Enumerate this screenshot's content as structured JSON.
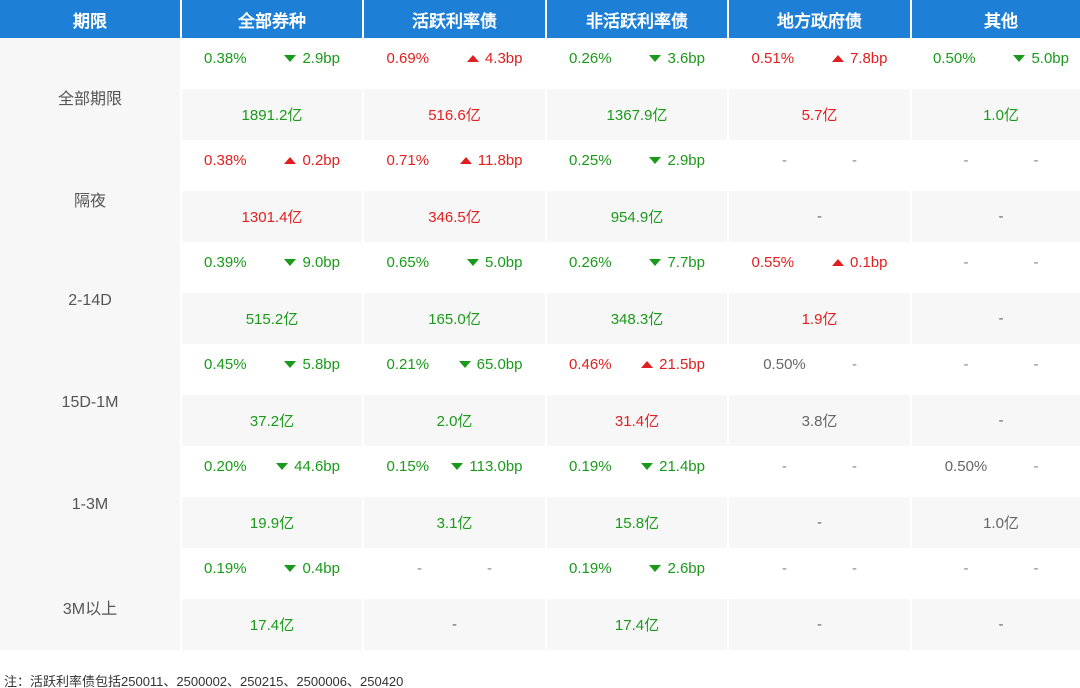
{
  "chart_data": {
    "type": "table",
    "headers": [
      "期限",
      "全部券种",
      "活跃利率债",
      "非活跃利率债",
      "地方政府债",
      "其他"
    ],
    "rows": [
      {
        "label": "全部期限",
        "cells": [
          {
            "rate": "0.38%",
            "dir": "down",
            "change": "2.9bp",
            "vol": "1891.2亿"
          },
          {
            "rate": "0.69%",
            "dir": "up",
            "change": "4.3bp",
            "vol": "516.6亿"
          },
          {
            "rate": "0.26%",
            "dir": "down",
            "change": "3.6bp",
            "vol": "1367.9亿"
          },
          {
            "rate": "0.51%",
            "dir": "up",
            "change": "7.8bp",
            "vol": "5.7亿"
          },
          {
            "rate": "0.50%",
            "dir": "down",
            "change": "5.0bp",
            "vol": "1.0亿"
          }
        ]
      },
      {
        "label": "隔夜",
        "cells": [
          {
            "rate": "0.38%",
            "dir": "up",
            "change": "0.2bp",
            "vol": "1301.4亿"
          },
          {
            "rate": "0.71%",
            "dir": "up",
            "change": "11.8bp",
            "vol": "346.5亿"
          },
          {
            "rate": "0.25%",
            "dir": "down",
            "change": "2.9bp",
            "vol": "954.9亿"
          },
          {
            "rate": "-",
            "dir": "none",
            "change": "-",
            "vol": "-"
          },
          {
            "rate": "-",
            "dir": "none",
            "change": "-",
            "vol": "-"
          }
        ]
      },
      {
        "label": "2-14D",
        "cells": [
          {
            "rate": "0.39%",
            "dir": "down",
            "change": "9.0bp",
            "vol": "515.2亿"
          },
          {
            "rate": "0.65%",
            "dir": "down",
            "change": "5.0bp",
            "vol": "165.0亿"
          },
          {
            "rate": "0.26%",
            "dir": "down",
            "change": "7.7bp",
            "vol": "348.3亿"
          },
          {
            "rate": "0.55%",
            "dir": "up",
            "change": "0.1bp",
            "vol": "1.9亿"
          },
          {
            "rate": "-",
            "dir": "none",
            "change": "-",
            "vol": "-"
          }
        ]
      },
      {
        "label": "15D-1M",
        "cells": [
          {
            "rate": "0.45%",
            "dir": "down",
            "change": "5.8bp",
            "vol": "37.2亿"
          },
          {
            "rate": "0.21%",
            "dir": "down",
            "change": "65.0bp",
            "vol": "2.0亿"
          },
          {
            "rate": "0.46%",
            "dir": "up",
            "change": "21.5bp",
            "vol": "31.4亿"
          },
          {
            "rate": "0.50%",
            "dir": "none",
            "change": "-",
            "vol": "3.8亿"
          },
          {
            "rate": "-",
            "dir": "none",
            "change": "-",
            "vol": "-"
          }
        ]
      },
      {
        "label": "1-3M",
        "cells": [
          {
            "rate": "0.20%",
            "dir": "down",
            "change": "44.6bp",
            "vol": "19.9亿"
          },
          {
            "rate": "0.15%",
            "dir": "down",
            "change": "113.0bp",
            "vol": "3.1亿"
          },
          {
            "rate": "0.19%",
            "dir": "down",
            "change": "21.4bp",
            "vol": "15.8亿"
          },
          {
            "rate": "-",
            "dir": "none",
            "change": "-",
            "vol": "-"
          },
          {
            "rate": "0.50%",
            "dir": "none",
            "change": "-",
            "vol": "1.0亿"
          }
        ]
      },
      {
        "label": "3M以上",
        "cells": [
          {
            "rate": "0.19%",
            "dir": "down",
            "change": "0.4bp",
            "vol": "17.4亿"
          },
          {
            "rate": "-",
            "dir": "none",
            "change": "-",
            "vol": "-"
          },
          {
            "rate": "0.19%",
            "dir": "down",
            "change": "2.6bp",
            "vol": "17.4亿"
          },
          {
            "rate": "-",
            "dir": "none",
            "change": "-",
            "vol": "-"
          },
          {
            "rate": "-",
            "dir": "none",
            "change": "-",
            "vol": "-"
          }
        ]
      }
    ]
  },
  "note": "注：活跃利率债包括250011、2500002、250215、2500006、250420",
  "colors": {
    "header_bg": "#1e7fd6",
    "up": "#e02020",
    "down": "#1a9a1a",
    "neutral": "#666666",
    "band": "#f7f7f7"
  }
}
